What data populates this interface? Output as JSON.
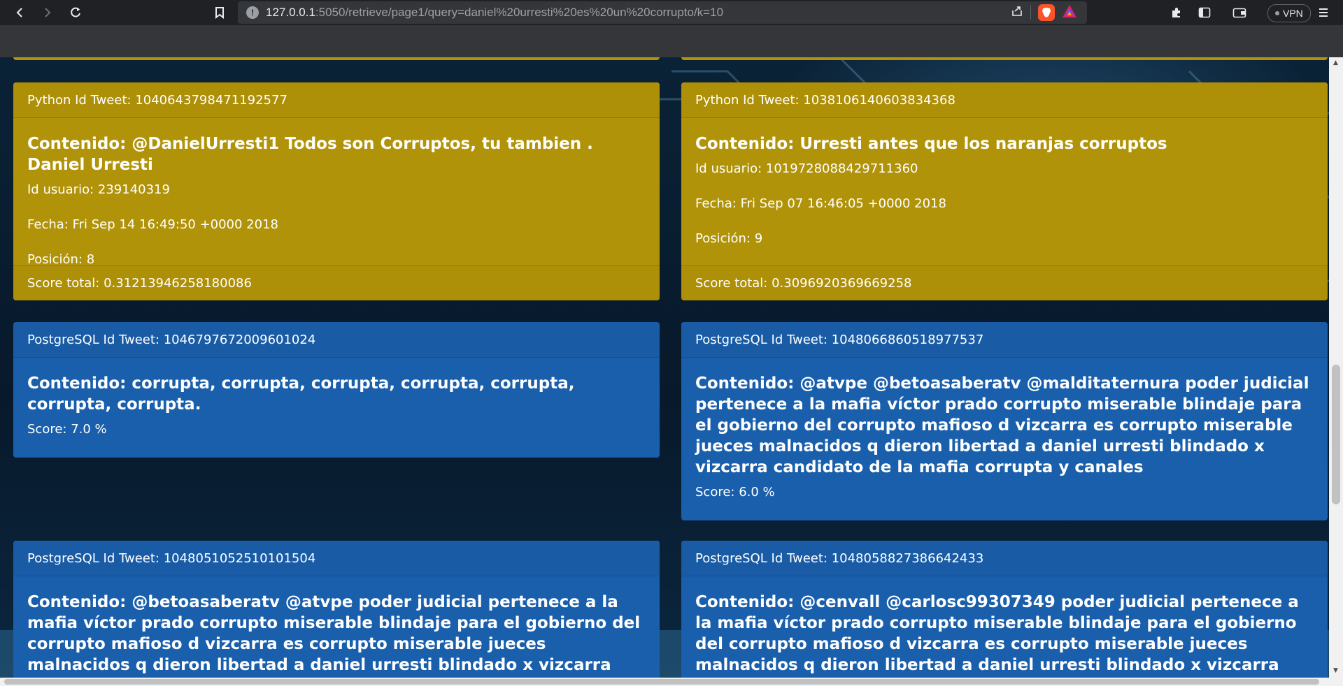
{
  "browser": {
    "url_host": "127.0.0.1",
    "url_rest": ":5050/retrieve/page1/query=daniel%20urresti%20es%20un%20corrupto/k=10",
    "vpn_label": "VPN"
  },
  "cards": {
    "py_left": {
      "header": "Python Id Tweet: 1040643798471192577",
      "content": "Contenido: @DanielUrresti1 Todos son Corruptos, tu tambien . Daniel Urresti",
      "user": "Id usuario: 239140319",
      "date": "Fecha: Fri Sep 14 16:49:50 +0000 2018",
      "position": "Posición: 8",
      "score": "Score total: 0.31213946258180086"
    },
    "py_right": {
      "header": "Python Id Tweet: 1038106140603834368",
      "content": "Contenido: Urresti antes que los naranjas corruptos",
      "user": "Id usuario: 1019728088429711360",
      "date": "Fecha: Fri Sep 07 16:46:05 +0000 2018",
      "position": "Posición: 9",
      "score": "Score total: 0.3096920369669258"
    },
    "pg_1": {
      "header": "PostgreSQL Id Tweet: 1046797672009601024",
      "content": "Contenido: corrupta, corrupta, corrupta, corrupta, corrupta, corrupta, corrupta.",
      "score": "Score: 7.0 %"
    },
    "pg_2": {
      "header": "PostgreSQL Id Tweet: 1048066860518977537",
      "content": "Contenido: @atvpe @betoasaberatv @malditaternura poder judicial pertenece a la mafia víctor prado corrupto miserable blindaje para el gobierno del corrupto mafioso d vizcarra es corrupto miserable jueces malnacidos q dieron libertad a daniel urresti blindado x vizcarra candidato de la mafia corrupta y canales",
      "score": "Score: 6.0 %"
    },
    "pg_3": {
      "header": "PostgreSQL Id Tweet: 1048051052510101504",
      "content": "Contenido: @betoasaberatv @atvpe poder judicial pertenece a la mafia víctor prado corrupto miserable blindaje para el gobierno del corrupto mafioso d vizcarra es corrupto miserable jueces malnacidos q dieron libertad a daniel urresti blindado x vizcarra candidato de la mafia corrupta y canales"
    },
    "pg_4": {
      "header": "PostgreSQL Id Tweet: 1048058827386642433",
      "content": "Contenido: @cenvall @carlosc99307349 poder judicial pertenece a la mafia víctor prado corrupto miserable blindaje para el gobierno del corrupto mafioso d vizcarra es corrupto miserable jueces malnacidos q dieron libertad a daniel urresti blindado x vizcarra candidato de la mafia corrupta y canales"
    }
  }
}
